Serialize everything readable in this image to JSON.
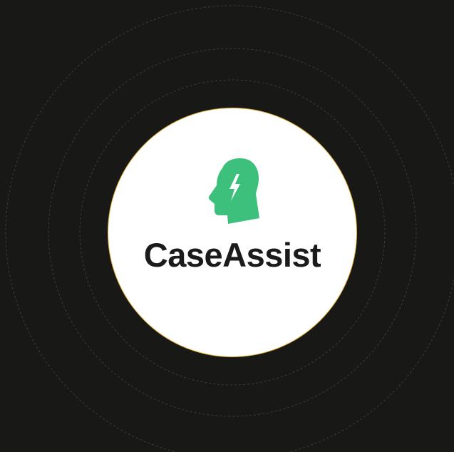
{
  "brand": {
    "name": "CaseAssist",
    "icon": "head-lightning-icon",
    "icon_color": "#3dc07b",
    "text_color": "#1b1b1b",
    "badge_border_color": "#e2b13a"
  },
  "background": {
    "color": "#181816",
    "ring_color": "#3c3c38"
  }
}
